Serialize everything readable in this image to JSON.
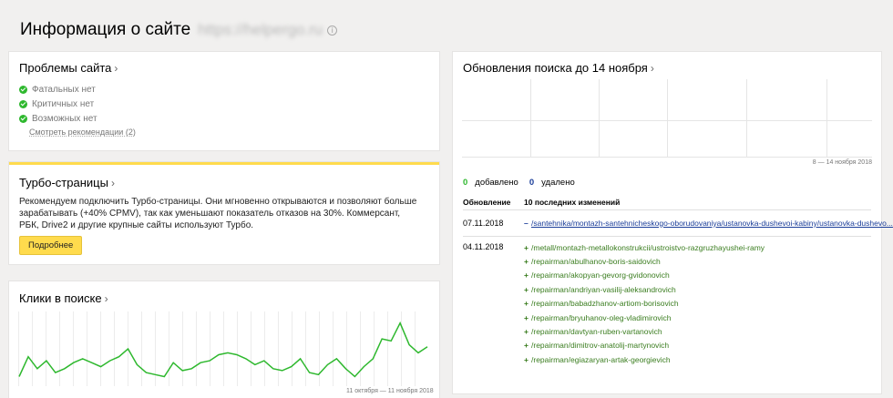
{
  "page": {
    "title": "Информация о сайте",
    "site_url": "https://helpergo.ru"
  },
  "problems": {
    "title": "Проблемы сайта",
    "items": [
      "Фатальных нет",
      "Критичных нет",
      "Возможных нет"
    ],
    "recommendations_link": "Смотреть рекомендации (2)"
  },
  "turbo": {
    "title": "Турбо-страницы",
    "text": "Рекомендуем подключить Турбо-страницы. Они мгновенно открываются и позволяют больше зарабатывать (+40% CPMV), так как уменьшают показатель отказов на 30%. Коммерсант, РБК, Drive2 и другие крупные сайты используют Турбо.",
    "button": "Подробнее",
    "accent_color": "#ffdb4d"
  },
  "clicks": {
    "title": "Клики в поиске",
    "date_range": "11 октября — 11 ноября 2018"
  },
  "chart_data": {
    "type": "line",
    "title": "Клики в поиске",
    "series": [
      {
        "values": [
          3,
          13,
          7,
          11,
          5,
          7,
          10,
          12,
          10,
          8,
          11,
          13,
          17,
          9,
          5,
          4,
          3,
          10,
          6,
          7,
          10,
          11,
          14,
          15,
          14,
          12,
          9,
          11,
          7,
          6,
          8,
          12,
          5,
          4,
          9,
          12,
          7,
          3,
          8,
          12,
          22,
          21,
          30,
          19,
          15,
          18
        ]
      }
    ],
    "color": "#2eb82e",
    "grid": true
  },
  "updates": {
    "title": "Обновления поиска до 14 ноября",
    "date_range": "8 — 14 ноября 2018",
    "added_count": "0",
    "added_label": "добавлено",
    "deleted_count": "0",
    "deleted_label": "удалено",
    "col_update": "Обновление",
    "col_changes": "10 последних изменений",
    "rows": [
      {
        "date": "07.11.2018",
        "links": [
          {
            "sign": "–",
            "type": "del",
            "path": "/santehnika/montazh-santehnicheskogo-oborudovaniya/ustanovka-dushevoi-kabiny/ustanovka-dushevo..."
          }
        ]
      },
      {
        "date": "04.11.2018",
        "links": [
          {
            "sign": "+",
            "type": "add",
            "path": "/metall/montazh-metallokonstrukcii/ustroistvo-razgruzhayushei-ramy"
          },
          {
            "sign": "+",
            "type": "add",
            "path": "/repairman/abulhanov-boris-saidovich"
          },
          {
            "sign": "+",
            "type": "add",
            "path": "/repairman/akopyan-gevorg-gvidonovich"
          },
          {
            "sign": "+",
            "type": "add",
            "path": "/repairman/andriyan-vasilij-aleksandrovich"
          },
          {
            "sign": "+",
            "type": "add",
            "path": "/repairman/babadzhanov-artiom-borisovich"
          },
          {
            "sign": "+",
            "type": "add",
            "path": "/repairman/bryuhanov-oleg-vladimirovich"
          },
          {
            "sign": "+",
            "type": "add",
            "path": "/repairman/davtyan-ruben-vartanovich"
          },
          {
            "sign": "+",
            "type": "add",
            "path": "/repairman/dimitrov-anatolij-martynovich"
          },
          {
            "sign": "+",
            "type": "add",
            "path": "/repairman/egiazaryan-artak-georgievich"
          }
        ]
      }
    ]
  },
  "icons": {
    "info": "info-icon",
    "ok": "check-circle-icon",
    "chevron": "chevron-right-icon"
  }
}
